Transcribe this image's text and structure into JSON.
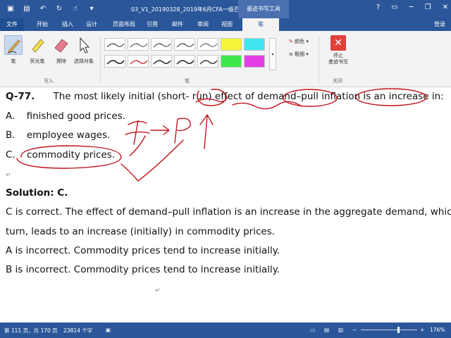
{
  "window": {
    "title": "03_V1_20190328_2019年6月CFA一级百题班...",
    "context_tab": "墨迹书写工具",
    "user": "登录"
  },
  "tabs": {
    "file": "文件",
    "items": [
      "开始",
      "插入",
      "设计",
      "页面布局",
      "引用",
      "邮件",
      "审阅",
      "视图"
    ],
    "active": "笔"
  },
  "ribbon": {
    "write_tools": [
      {
        "label": "笔",
        "icon": "pen-icon",
        "selected": true
      },
      {
        "label": "荧光笔",
        "icon": "highlighter-icon",
        "selected": false
      },
      {
        "label": "擦除",
        "icon": "eraser-icon",
        "selected": false
      },
      {
        "label": "选择对象",
        "icon": "select-cursor-icon",
        "selected": false
      }
    ],
    "group_write": "写入",
    "group_pen": "笔",
    "color_label": "颜色",
    "thickness_label": "粗细",
    "stop_label_1": "停止",
    "stop_label_2": "墨迹书写",
    "group_close": "关闭"
  },
  "document": {
    "question_num": "Q-77.",
    "question_text": "The most likely initial (short- run) effect of demand–pull inflation is an increase in:",
    "options": [
      {
        "letter": "A.",
        "text": "finished good prices."
      },
      {
        "letter": "B.",
        "text": "employee wages."
      },
      {
        "letter": "C.",
        "text": "commodity prices."
      }
    ],
    "solution_label": "Solution: C.",
    "explanation": [
      "C is correct. The effect of demand–pull inflation is an increase in the aggregate demand, which, in",
      "turn, leads to an increase (initially) in commodity prices.",
      "A is incorrect. Commodity prices tend to increase initially.",
      "B is incorrect. Commodity prices tend to increase initially."
    ],
    "para_mark": "↵"
  },
  "status": {
    "page": "第 111 页，共 170 页",
    "words": "23814 个字",
    "zoom": "176%"
  },
  "ink_color": "#c0141c"
}
